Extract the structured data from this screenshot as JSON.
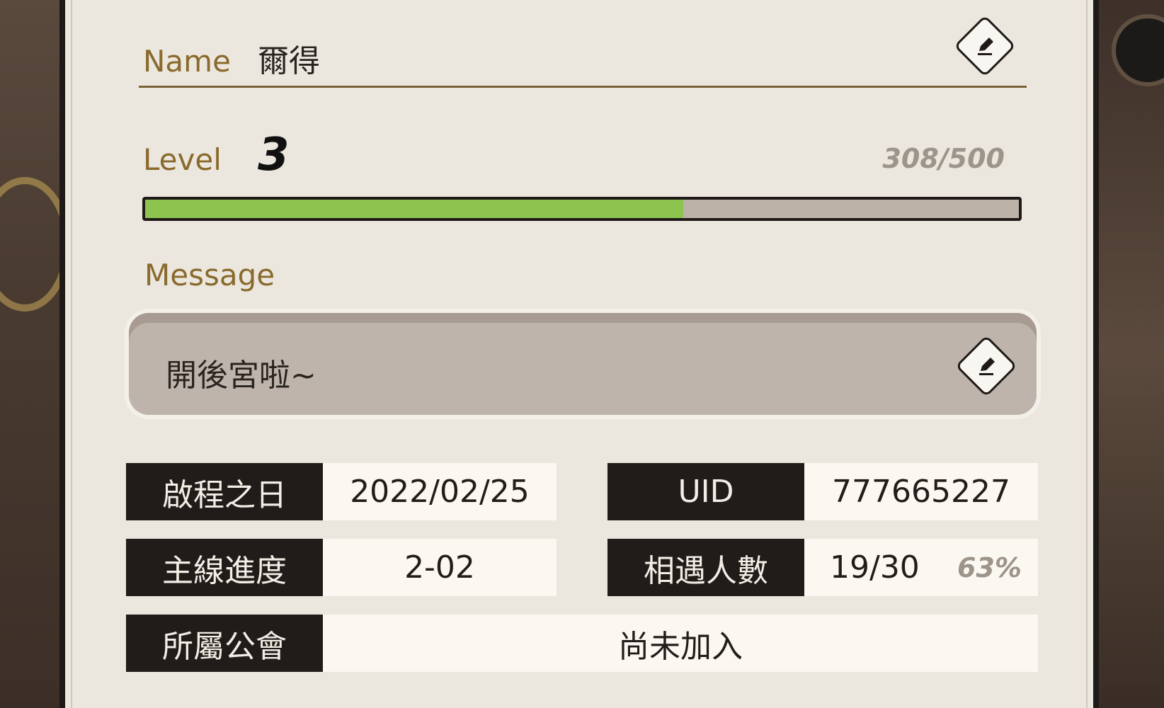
{
  "profile": {
    "name_label": "Name",
    "name_value": "爾得",
    "level_label": "Level",
    "level_value": "3",
    "exp_text": "308/500",
    "exp_fraction": 0.616,
    "message_label": "Message",
    "message_value": "開後宮啦~"
  },
  "info": {
    "start_date_label": "啟程之日",
    "start_date_value": "2022/02/25",
    "uid_label": "UID",
    "uid_value": "777665227",
    "main_progress_label": "主線進度",
    "main_progress_value": "2-02",
    "encounters_label": "相遇人數",
    "encounters_value": "19/30",
    "encounters_percent": "63%",
    "guild_label": "所屬公會",
    "guild_value": "尚未加入"
  },
  "icons": {
    "name_edit": "edit-pencil-icon",
    "message_edit": "edit-pencil-icon"
  },
  "colors": {
    "exp_fill": "#8dc450",
    "gold_label": "#8a6a2c",
    "dark_cell": "#211c19"
  }
}
